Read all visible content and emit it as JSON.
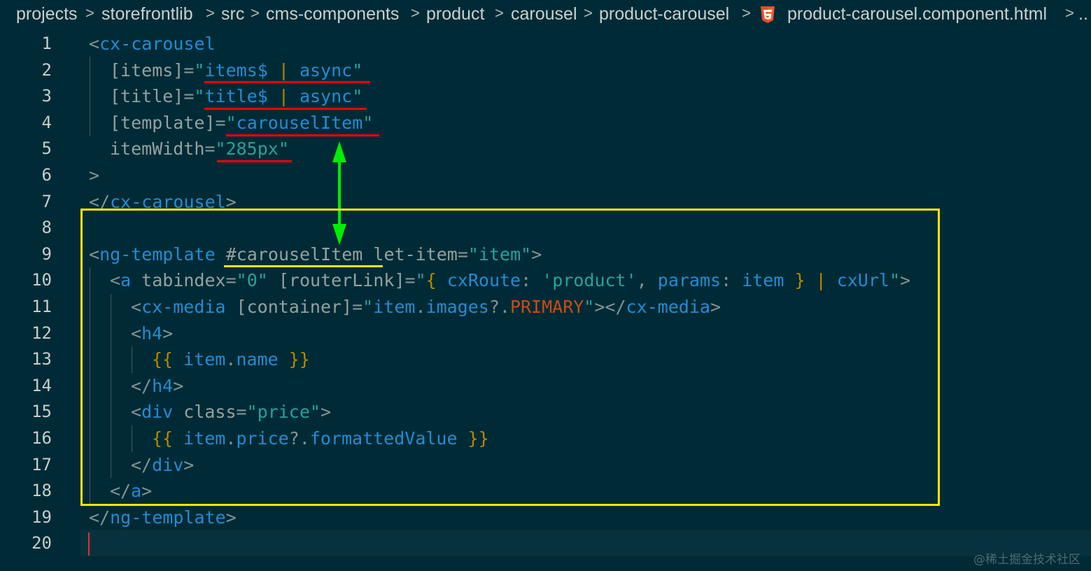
{
  "breadcrumb": {
    "items": [
      "projects",
      "storefrontlib",
      "src",
      "cms-components",
      "product",
      "carousel",
      "product-carousel",
      "product-carousel.component.html"
    ],
    "separator": ">",
    "overflow": "..",
    "file_icon": "html5-icon"
  },
  "editor": {
    "line_numbers": [
      "1",
      "2",
      "3",
      "4",
      "5",
      "6",
      "7",
      "8",
      "9",
      "10",
      "11",
      "12",
      "13",
      "14",
      "15",
      "16",
      "17",
      "18",
      "19",
      "20"
    ],
    "lines": [
      [
        [
          "<",
          "p"
        ],
        [
          "cx-carousel",
          "t"
        ]
      ],
      [
        [
          "[items]",
          "a"
        ],
        [
          "=",
          "p"
        ],
        [
          "\"",
          "s"
        ],
        [
          "items$ ",
          "v"
        ],
        [
          "|",
          "o"
        ],
        [
          " async",
          "v"
        ],
        [
          "\"",
          "s"
        ]
      ],
      [
        [
          "[title]",
          "a"
        ],
        [
          "=",
          "p"
        ],
        [
          "\"",
          "s"
        ],
        [
          "title$ ",
          "v"
        ],
        [
          "|",
          "o"
        ],
        [
          " async",
          "v"
        ],
        [
          "\"",
          "s"
        ]
      ],
      [
        [
          "[template]",
          "a"
        ],
        [
          "=",
          "p"
        ],
        [
          "\"",
          "s"
        ],
        [
          "carouselItem",
          "v"
        ],
        [
          "\"",
          "s"
        ]
      ],
      [
        [
          "itemWidth",
          "a"
        ],
        [
          "=",
          "p"
        ],
        [
          "\"285px\"",
          "s"
        ]
      ],
      [
        [
          ">",
          "p"
        ]
      ],
      [
        [
          "</",
          "p"
        ],
        [
          "cx-carousel",
          "t"
        ],
        [
          ">",
          "p"
        ]
      ],
      [],
      [
        [
          "<",
          "p"
        ],
        [
          "ng-template",
          "t"
        ],
        [
          " #carouselItem let-item",
          "a"
        ],
        [
          "=",
          "p"
        ],
        [
          "\"item\"",
          "s"
        ],
        [
          ">",
          "p"
        ]
      ],
      [
        [
          "<",
          "p"
        ],
        [
          "a",
          "t"
        ],
        [
          " tabindex",
          "a"
        ],
        [
          "=",
          "p"
        ],
        [
          "\"0\" ",
          "s"
        ],
        [
          "[routerLink]",
          "a"
        ],
        [
          "=",
          "p"
        ],
        [
          "\"",
          "s"
        ],
        [
          "{ ",
          "b"
        ],
        [
          "cxRoute",
          "v"
        ],
        [
          ": ",
          "p"
        ],
        [
          "'product'",
          "s"
        ],
        [
          ", ",
          "p"
        ],
        [
          "params",
          "v"
        ],
        [
          ": ",
          "p"
        ],
        [
          "item",
          "v"
        ],
        [
          " }",
          "b"
        ],
        [
          " | ",
          "o"
        ],
        [
          "cxUrl",
          "v"
        ],
        [
          "\"",
          "s"
        ],
        [
          ">",
          "p"
        ]
      ],
      [
        [
          "<",
          "p"
        ],
        [
          "cx-media",
          "t"
        ],
        [
          " [container]",
          "a"
        ],
        [
          "=",
          "p"
        ],
        [
          "\"",
          "s"
        ],
        [
          "item",
          "v"
        ],
        [
          ".",
          "p"
        ],
        [
          "images",
          "v"
        ],
        [
          "?.",
          "p"
        ],
        [
          "PRIMARY",
          "k"
        ],
        [
          "\"",
          "s"
        ],
        [
          "></",
          "p"
        ],
        [
          "cx-media",
          "t"
        ],
        [
          ">",
          "p"
        ]
      ],
      [
        [
          "<",
          "p"
        ],
        [
          "h4",
          "t"
        ],
        [
          ">",
          "p"
        ]
      ],
      [
        [
          "{{ ",
          "b"
        ],
        [
          "item",
          "v"
        ],
        [
          ".",
          "p"
        ],
        [
          "name",
          "v"
        ],
        [
          " }}",
          "b"
        ]
      ],
      [
        [
          "</",
          "p"
        ],
        [
          "h4",
          "t"
        ],
        [
          ">",
          "p"
        ]
      ],
      [
        [
          "<",
          "p"
        ],
        [
          "div",
          "t"
        ],
        [
          " class",
          "a"
        ],
        [
          "=",
          "p"
        ],
        [
          "\"price\"",
          "s"
        ],
        [
          ">",
          "p"
        ]
      ],
      [
        [
          "{{ ",
          "b"
        ],
        [
          "item",
          "v"
        ],
        [
          ".",
          "p"
        ],
        [
          "price",
          "v"
        ],
        [
          "?.",
          "p"
        ],
        [
          "formattedValue",
          "v"
        ],
        [
          " }}",
          "b"
        ]
      ],
      [
        [
          "</",
          "p"
        ],
        [
          "div",
          "t"
        ],
        [
          ">",
          "p"
        ]
      ],
      [
        [
          "</",
          "p"
        ],
        [
          "a",
          "t"
        ],
        [
          ">",
          "p"
        ]
      ],
      [
        [
          "</",
          "p"
        ],
        [
          "ng-template",
          "t"
        ],
        [
          ">",
          "p"
        ]
      ],
      []
    ]
  },
  "colors": {
    "background": "#002b36",
    "tag": "#268bd2",
    "attribute": "#93a1a1",
    "string": "#2aa198",
    "punctuation": "#839496",
    "keyword_constant": "#cb4b16",
    "brace": "#b58900",
    "annotation_red": "#ff0000",
    "annotation_yellow": "#ffe600",
    "annotation_green_arrow": "#00ee00"
  },
  "watermark": "@稀土掘金技术社区"
}
